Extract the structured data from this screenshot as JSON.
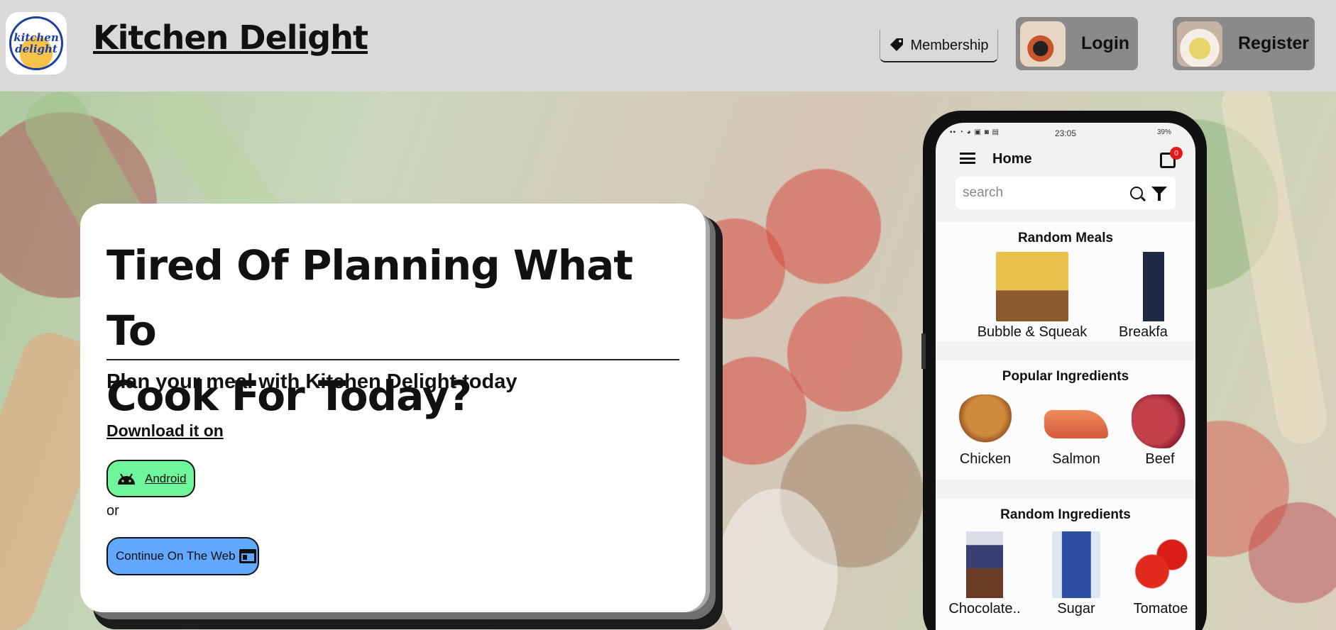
{
  "header": {
    "logo_text_1": "kitchen",
    "logo_text_2": "delight",
    "brand": "Kitchen Delight",
    "membership_label": "Membership",
    "login_label": "Login",
    "register_label": "Register"
  },
  "hero": {
    "headline_line1": "Tired Of Planning What To",
    "headline_line2": "Cook For Today?",
    "subhead": "Plan your meal with Kitchen Delight today",
    "download_label": "Download it on",
    "android_label": "Android",
    "or_label": "or",
    "web_label": "Continue On The Web"
  },
  "phone": {
    "time": "23:05",
    "battery": "39%",
    "title": "Home",
    "cart_count": "0",
    "search_placeholder": "search",
    "random_meals_title": "Random Meals",
    "random_meals": [
      "Bubble & Squeak",
      "Breakfa"
    ],
    "popular_title": "Popular Ingredients",
    "popular": [
      "Chicken",
      "Salmon",
      "Beef"
    ],
    "random_ingredients_title": "Random Ingredients",
    "random_ingredients": [
      "Chocolate..",
      "Sugar",
      "Tomatoe"
    ]
  },
  "colors": {
    "android_green": "#6ff59a",
    "web_blue": "#63a8ff",
    "header_gray": "#d9d9d9",
    "badge_red": "#e61818"
  }
}
